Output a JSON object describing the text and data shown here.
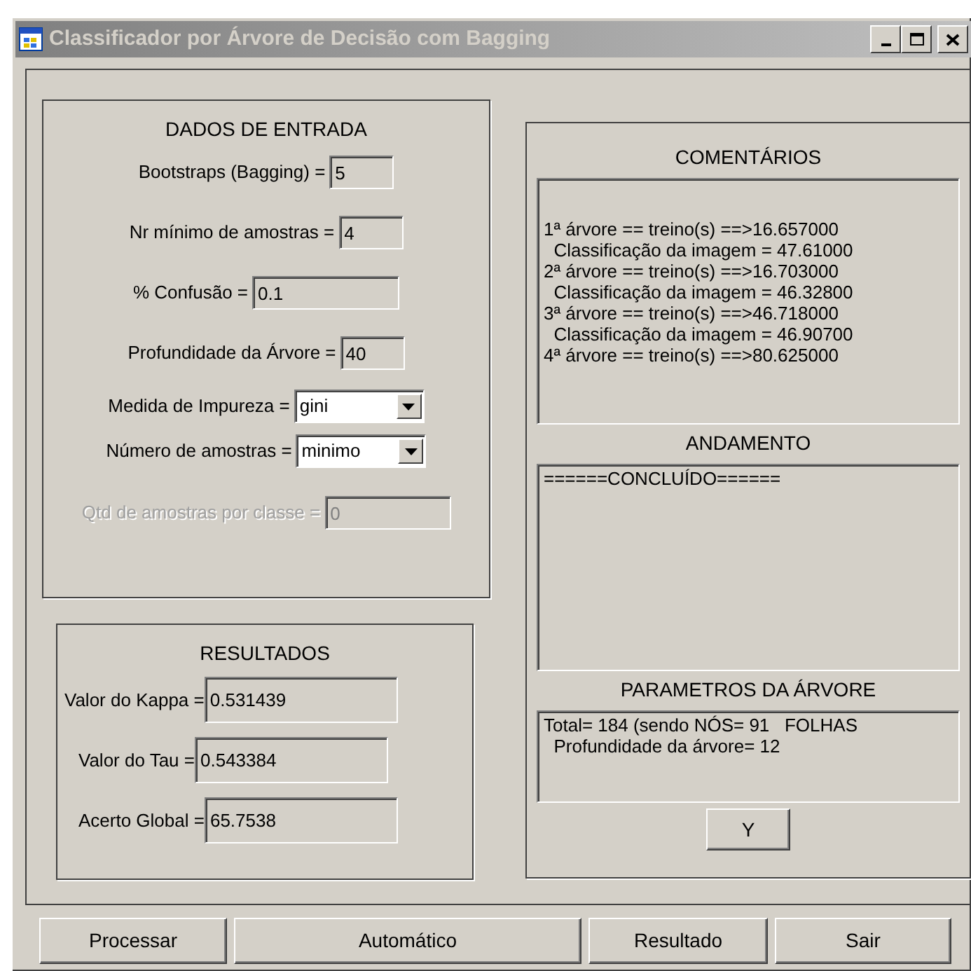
{
  "window": {
    "title": "Classificador por Árvore de Decisão com Bagging"
  },
  "input_panel": {
    "title": "DADOS DE ENTRADA",
    "fields": [
      {
        "kind": "text",
        "label": "Bootstraps (Bagging) =",
        "value": "5",
        "disabled": false
      },
      {
        "kind": "text",
        "label": "Nr mínimo de amostras =",
        "value": "4",
        "disabled": false
      },
      {
        "kind": "text",
        "label": "% Confusão =",
        "value": "0.1",
        "disabled": false
      },
      {
        "kind": "text",
        "label": "Profundidade da Árvore =",
        "value": "40",
        "disabled": false
      },
      {
        "kind": "select",
        "label": "Medida de Impureza =",
        "value": "gini",
        "disabled": false
      },
      {
        "kind": "select",
        "label": "Número de amostras =",
        "value": "minimo",
        "disabled": false
      },
      {
        "kind": "text",
        "label": "Qtd de amostras por classe =",
        "value": "0",
        "disabled": true
      }
    ]
  },
  "results_panel": {
    "title": "RESULTADOS",
    "fields": [
      {
        "label": "Valor do Kappa =",
        "value": "0.531439"
      },
      {
        "label": "Valor do Tau =",
        "value": "0.543384"
      },
      {
        "label": "Acerto Global =",
        "value": "65.7538"
      }
    ]
  },
  "right_panel": {
    "sections": [
      {
        "title": "COMENTÁRIOS",
        "lines": [
          "1ª árvore == treino(s) ==>16.657000",
          "  Classificação da imagem = 47.61000",
          "2ª árvore == treino(s) ==>16.703000",
          "  Classificação da imagem = 46.32800",
          "3ª árvore == treino(s) ==>46.718000",
          "  Classificação da imagem = 46.90700",
          "4ª árvore == treino(s) ==>80.625000"
        ]
      },
      {
        "title": "ANDAMENTO",
        "lines": [
          "======CONCLUÍDO======"
        ]
      },
      {
        "title": "PARAMETROS DA ÁRVORE",
        "lines": [
          "Total= 184 (sendo NÓS= 91   FOLHAS",
          "  Profundidade da árvore= 12"
        ]
      }
    ],
    "button": "Y"
  },
  "buttons": [
    "Processar",
    "Automático",
    "Resultado",
    "Sair"
  ]
}
